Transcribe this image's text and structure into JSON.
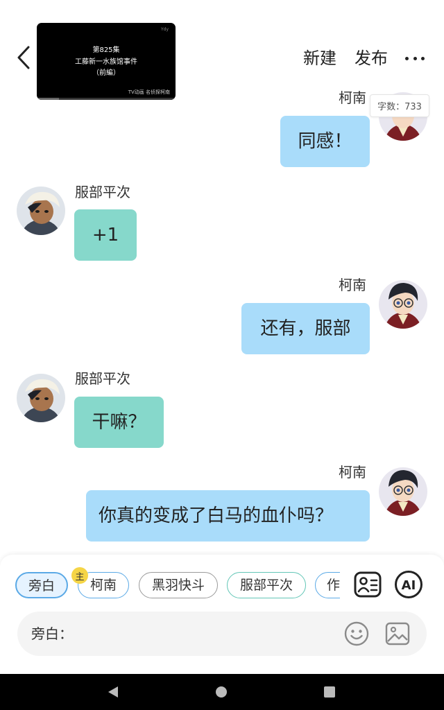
{
  "header": {
    "video": {
      "line1": "第825集",
      "line2": "工藤新一水族馆事件",
      "line3": "（前編）",
      "watermark": "TV动画 名侦探柯南"
    },
    "new_label": "新建",
    "publish_label": "发布",
    "word_count": "字数：733"
  },
  "messages": [
    {
      "side": "right",
      "speaker": "柯南",
      "text": "同感！",
      "avatar": "conan-avatar"
    },
    {
      "side": "left",
      "speaker": "服部平次",
      "text": "+1",
      "avatar": "heiji-avatar"
    },
    {
      "side": "right",
      "speaker": "柯南",
      "text": "还有，服部",
      "avatar": "conan-avatar"
    },
    {
      "side": "left",
      "speaker": "服部平次",
      "text": "干嘛？",
      "avatar": "heiji-avatar"
    },
    {
      "side": "right",
      "speaker": "柯南",
      "text": "你真的变成了白马的血仆吗？",
      "avatar": "conan-avatar"
    }
  ],
  "composer": {
    "roles": [
      "旁白",
      "柯南",
      "黑羽快斗",
      "服部平次",
      "作"
    ],
    "selected_role": "旁白",
    "main_badge": "主",
    "ai_label": "AI",
    "input_placeholder": "旁白：",
    "input_value": ""
  },
  "colors": {
    "right_bubble": "#a9dcfa",
    "left_bubble": "#86d8cb",
    "chip_blue": "#5aa9e6",
    "chip_teal": "#62c6b6",
    "badge_yellow": "#f5d547"
  }
}
